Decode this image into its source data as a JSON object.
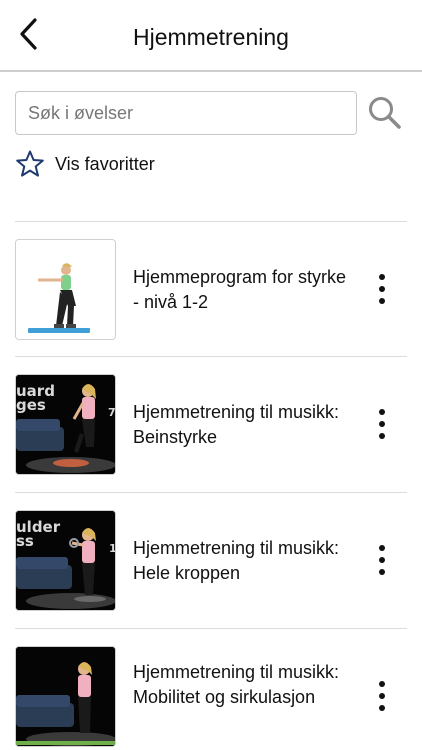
{
  "header": {
    "title": "Hjemmetrening",
    "back_icon": "chevron-left-icon"
  },
  "search": {
    "placeholder": "Søk i øvelser",
    "value": "",
    "icon": "search-icon"
  },
  "favorites": {
    "label": "Vis favoritter",
    "icon": "star-outline-icon",
    "icon_color": "#1f3a6e"
  },
  "items": [
    {
      "title": "Hjemmeprogram for styrke - nivå 1-2",
      "thumb_overlay": []
    },
    {
      "title": "Hjemmetrening til musikk: Beinstyrke",
      "thumb_overlay": [
        "uard",
        "ges",
        "7"
      ]
    },
    {
      "title": "Hjemmetrening til musikk: Hele kroppen",
      "thumb_overlay": [
        "ulder",
        "ss",
        "1"
      ]
    },
    {
      "title": "Hjemmetrening til musikk: Mobilitet og sirkulasjon",
      "thumb_overlay": []
    }
  ]
}
